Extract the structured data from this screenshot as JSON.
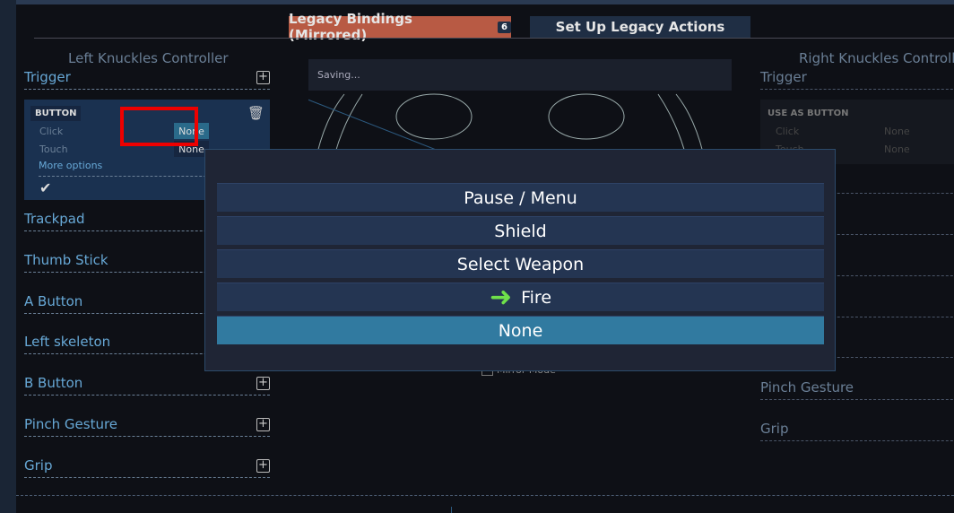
{
  "tabs": [
    {
      "label": "Legacy Bindings (Mirrored)",
      "badge": "6",
      "active": true
    },
    {
      "label": "Set Up Legacy Actions"
    }
  ],
  "left": {
    "title": "Left Knuckles Controller",
    "trigger": "Trigger",
    "card": {
      "mode": "BUTTON",
      "click_label": "Click",
      "click_value": "None",
      "touch_label": "Touch",
      "touch_value": "None",
      "more": "More options"
    },
    "items": [
      "Trackpad",
      "Thumb Stick",
      "A Button",
      "Left skeleton",
      "B Button",
      "Pinch Gesture",
      "Grip"
    ]
  },
  "right": {
    "title": "Right Knuckles Controller",
    "trigger": "Trigger",
    "card": {
      "mode": "USE AS BUTTON",
      "click_label": "Click",
      "click_value": "None",
      "touch_label": "Touch",
      "touch_value": "None"
    },
    "items": [
      "Pinch Gesture",
      "Grip"
    ]
  },
  "status": "Saving...",
  "mirror_mode": "Mirror Mode",
  "menu": {
    "options": [
      "Pause / Menu",
      "Shield",
      "Select Weapon",
      "Fire",
      "None"
    ],
    "selected": "None",
    "pointer": "Fire"
  },
  "colors": {
    "accent": "#317aa0",
    "tab_active": "#b85a44",
    "highlight": "#ee0000",
    "arrow": "#6fe04a"
  }
}
